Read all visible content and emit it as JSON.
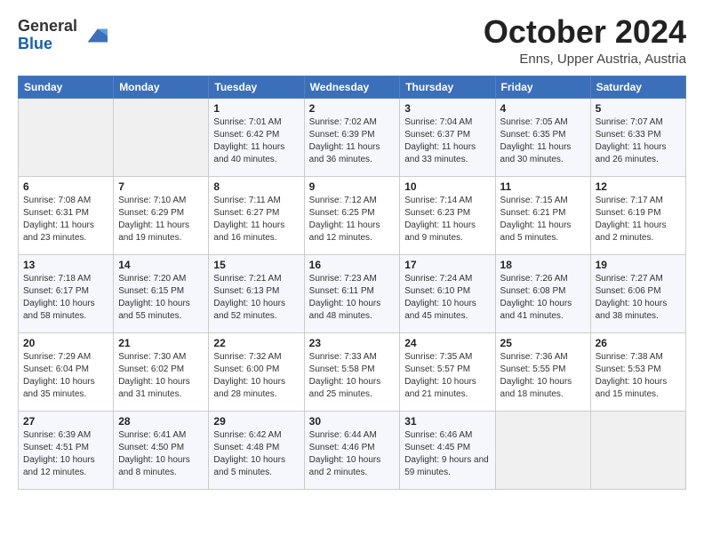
{
  "logo": {
    "general": "General",
    "blue": "Blue"
  },
  "header": {
    "month_title": "October 2024",
    "location": "Enns, Upper Austria, Austria"
  },
  "days_of_week": [
    "Sunday",
    "Monday",
    "Tuesday",
    "Wednesday",
    "Thursday",
    "Friday",
    "Saturday"
  ],
  "weeks": [
    [
      {
        "day": "",
        "detail": ""
      },
      {
        "day": "",
        "detail": ""
      },
      {
        "day": "1",
        "detail": "Sunrise: 7:01 AM\nSunset: 6:42 PM\nDaylight: 11 hours and 40 minutes."
      },
      {
        "day": "2",
        "detail": "Sunrise: 7:02 AM\nSunset: 6:39 PM\nDaylight: 11 hours and 36 minutes."
      },
      {
        "day": "3",
        "detail": "Sunrise: 7:04 AM\nSunset: 6:37 PM\nDaylight: 11 hours and 33 minutes."
      },
      {
        "day": "4",
        "detail": "Sunrise: 7:05 AM\nSunset: 6:35 PM\nDaylight: 11 hours and 30 minutes."
      },
      {
        "day": "5",
        "detail": "Sunrise: 7:07 AM\nSunset: 6:33 PM\nDaylight: 11 hours and 26 minutes."
      }
    ],
    [
      {
        "day": "6",
        "detail": "Sunrise: 7:08 AM\nSunset: 6:31 PM\nDaylight: 11 hours and 23 minutes."
      },
      {
        "day": "7",
        "detail": "Sunrise: 7:10 AM\nSunset: 6:29 PM\nDaylight: 11 hours and 19 minutes."
      },
      {
        "day": "8",
        "detail": "Sunrise: 7:11 AM\nSunset: 6:27 PM\nDaylight: 11 hours and 16 minutes."
      },
      {
        "day": "9",
        "detail": "Sunrise: 7:12 AM\nSunset: 6:25 PM\nDaylight: 11 hours and 12 minutes."
      },
      {
        "day": "10",
        "detail": "Sunrise: 7:14 AM\nSunset: 6:23 PM\nDaylight: 11 hours and 9 minutes."
      },
      {
        "day": "11",
        "detail": "Sunrise: 7:15 AM\nSunset: 6:21 PM\nDaylight: 11 hours and 5 minutes."
      },
      {
        "day": "12",
        "detail": "Sunrise: 7:17 AM\nSunset: 6:19 PM\nDaylight: 11 hours and 2 minutes."
      }
    ],
    [
      {
        "day": "13",
        "detail": "Sunrise: 7:18 AM\nSunset: 6:17 PM\nDaylight: 10 hours and 58 minutes."
      },
      {
        "day": "14",
        "detail": "Sunrise: 7:20 AM\nSunset: 6:15 PM\nDaylight: 10 hours and 55 minutes."
      },
      {
        "day": "15",
        "detail": "Sunrise: 7:21 AM\nSunset: 6:13 PM\nDaylight: 10 hours and 52 minutes."
      },
      {
        "day": "16",
        "detail": "Sunrise: 7:23 AM\nSunset: 6:11 PM\nDaylight: 10 hours and 48 minutes."
      },
      {
        "day": "17",
        "detail": "Sunrise: 7:24 AM\nSunset: 6:10 PM\nDaylight: 10 hours and 45 minutes."
      },
      {
        "day": "18",
        "detail": "Sunrise: 7:26 AM\nSunset: 6:08 PM\nDaylight: 10 hours and 41 minutes."
      },
      {
        "day": "19",
        "detail": "Sunrise: 7:27 AM\nSunset: 6:06 PM\nDaylight: 10 hours and 38 minutes."
      }
    ],
    [
      {
        "day": "20",
        "detail": "Sunrise: 7:29 AM\nSunset: 6:04 PM\nDaylight: 10 hours and 35 minutes."
      },
      {
        "day": "21",
        "detail": "Sunrise: 7:30 AM\nSunset: 6:02 PM\nDaylight: 10 hours and 31 minutes."
      },
      {
        "day": "22",
        "detail": "Sunrise: 7:32 AM\nSunset: 6:00 PM\nDaylight: 10 hours and 28 minutes."
      },
      {
        "day": "23",
        "detail": "Sunrise: 7:33 AM\nSunset: 5:58 PM\nDaylight: 10 hours and 25 minutes."
      },
      {
        "day": "24",
        "detail": "Sunrise: 7:35 AM\nSunset: 5:57 PM\nDaylight: 10 hours and 21 minutes."
      },
      {
        "day": "25",
        "detail": "Sunrise: 7:36 AM\nSunset: 5:55 PM\nDaylight: 10 hours and 18 minutes."
      },
      {
        "day": "26",
        "detail": "Sunrise: 7:38 AM\nSunset: 5:53 PM\nDaylight: 10 hours and 15 minutes."
      }
    ],
    [
      {
        "day": "27",
        "detail": "Sunrise: 6:39 AM\nSunset: 4:51 PM\nDaylight: 10 hours and 12 minutes."
      },
      {
        "day": "28",
        "detail": "Sunrise: 6:41 AM\nSunset: 4:50 PM\nDaylight: 10 hours and 8 minutes."
      },
      {
        "day": "29",
        "detail": "Sunrise: 6:42 AM\nSunset: 4:48 PM\nDaylight: 10 hours and 5 minutes."
      },
      {
        "day": "30",
        "detail": "Sunrise: 6:44 AM\nSunset: 4:46 PM\nDaylight: 10 hours and 2 minutes."
      },
      {
        "day": "31",
        "detail": "Sunrise: 6:46 AM\nSunset: 4:45 PM\nDaylight: 9 hours and 59 minutes."
      },
      {
        "day": "",
        "detail": ""
      },
      {
        "day": "",
        "detail": ""
      }
    ]
  ]
}
